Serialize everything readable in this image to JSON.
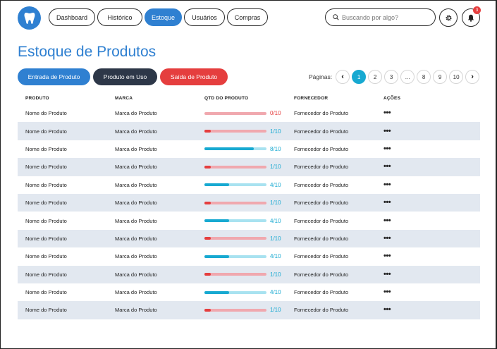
{
  "nav": [
    "Dashboard",
    "Histórico",
    "Estoque",
    "Usuários",
    "Compras"
  ],
  "nav_active": 2,
  "search": {
    "placeholder": "Buscando por algo?"
  },
  "notifications": {
    "count": "3"
  },
  "page_title": "Estoque de Produtos",
  "actions": {
    "entrada": "Entrada de Produto",
    "em_uso": "Produto em Uso",
    "saida": "Saída de Produto"
  },
  "pagination": {
    "label": "Páginas:",
    "pages": [
      "1",
      "2",
      "3",
      "...",
      "8",
      "9",
      "10"
    ],
    "current": "1",
    "prev": "‹",
    "next": "›"
  },
  "table": {
    "headers": {
      "product": "PRODUTO",
      "brand": "MARCA",
      "qty": "QTD DO PRODUTO",
      "supplier": "FORNECEDOR",
      "actions": "AÇÕES"
    },
    "rows": [
      {
        "product": "Nome do Produto",
        "brand": "Marca do Produto",
        "qty": "0/10",
        "level": 0,
        "supplier": "Fornecedor do Produto"
      },
      {
        "product": "Nome do Produto",
        "brand": "Marca do Produto",
        "qty": "1/10",
        "level": 0.1,
        "supplier": "Fornecedor do Produto"
      },
      {
        "product": "Nome do Produto",
        "brand": "Marca do Produto",
        "qty": "8/10",
        "level": 0.8,
        "supplier": "Fornecedor do Produto"
      },
      {
        "product": "Nome do Produto",
        "brand": "Marca do Produto",
        "qty": "1/10",
        "level": 0.1,
        "supplier": "Fornecedor do Produto"
      },
      {
        "product": "Nome do Produto",
        "brand": "Marca do Produto",
        "qty": "4/10",
        "level": 0.4,
        "supplier": "Fornecedor do Produto"
      },
      {
        "product": "Nome do Produto",
        "brand": "Marca do Produto",
        "qty": "1/10",
        "level": 0.1,
        "supplier": "Fornecedor do Produto"
      },
      {
        "product": "Nome do Produto",
        "brand": "Marca do Produto",
        "qty": "4/10",
        "level": 0.4,
        "supplier": "Fornecedor do Produto"
      },
      {
        "product": "Nome do Produto",
        "brand": "Marca do Produto",
        "qty": "1/10",
        "level": 0.1,
        "supplier": "Fornecedor do Produto"
      },
      {
        "product": "Nome do Produto",
        "brand": "Marca do Produto",
        "qty": "4/10",
        "level": 0.4,
        "supplier": "Fornecedor do Produto"
      },
      {
        "product": "Nome do Produto",
        "brand": "Marca do Produto",
        "qty": "1/10",
        "level": 0.1,
        "supplier": "Fornecedor do Produto"
      },
      {
        "product": "Nome do Produto",
        "brand": "Marca do Produto",
        "qty": "4/10",
        "level": 0.4,
        "supplier": "Fornecedor do Produto"
      },
      {
        "product": "Nome do Produto",
        "brand": "Marca do Produto",
        "qty": "1/10",
        "level": 0.1,
        "supplier": "Fornecedor do Produto"
      }
    ],
    "action_glyph": "•••"
  },
  "colors": {
    "primary": "#2f80d1",
    "dark": "#2d3748",
    "danger": "#e53e3e",
    "accent": "#17a9d1",
    "low_fill": "#e53e3e",
    "low_track": "#f0a8ae",
    "low_text": "#e53e3e",
    "ok_fill": "#17a9d1",
    "ok_track": "#a8e2f0",
    "ok_text": "#17a9d1",
    "zero_track": "#f0a8ae",
    "zero_text": "#e53e3e"
  }
}
